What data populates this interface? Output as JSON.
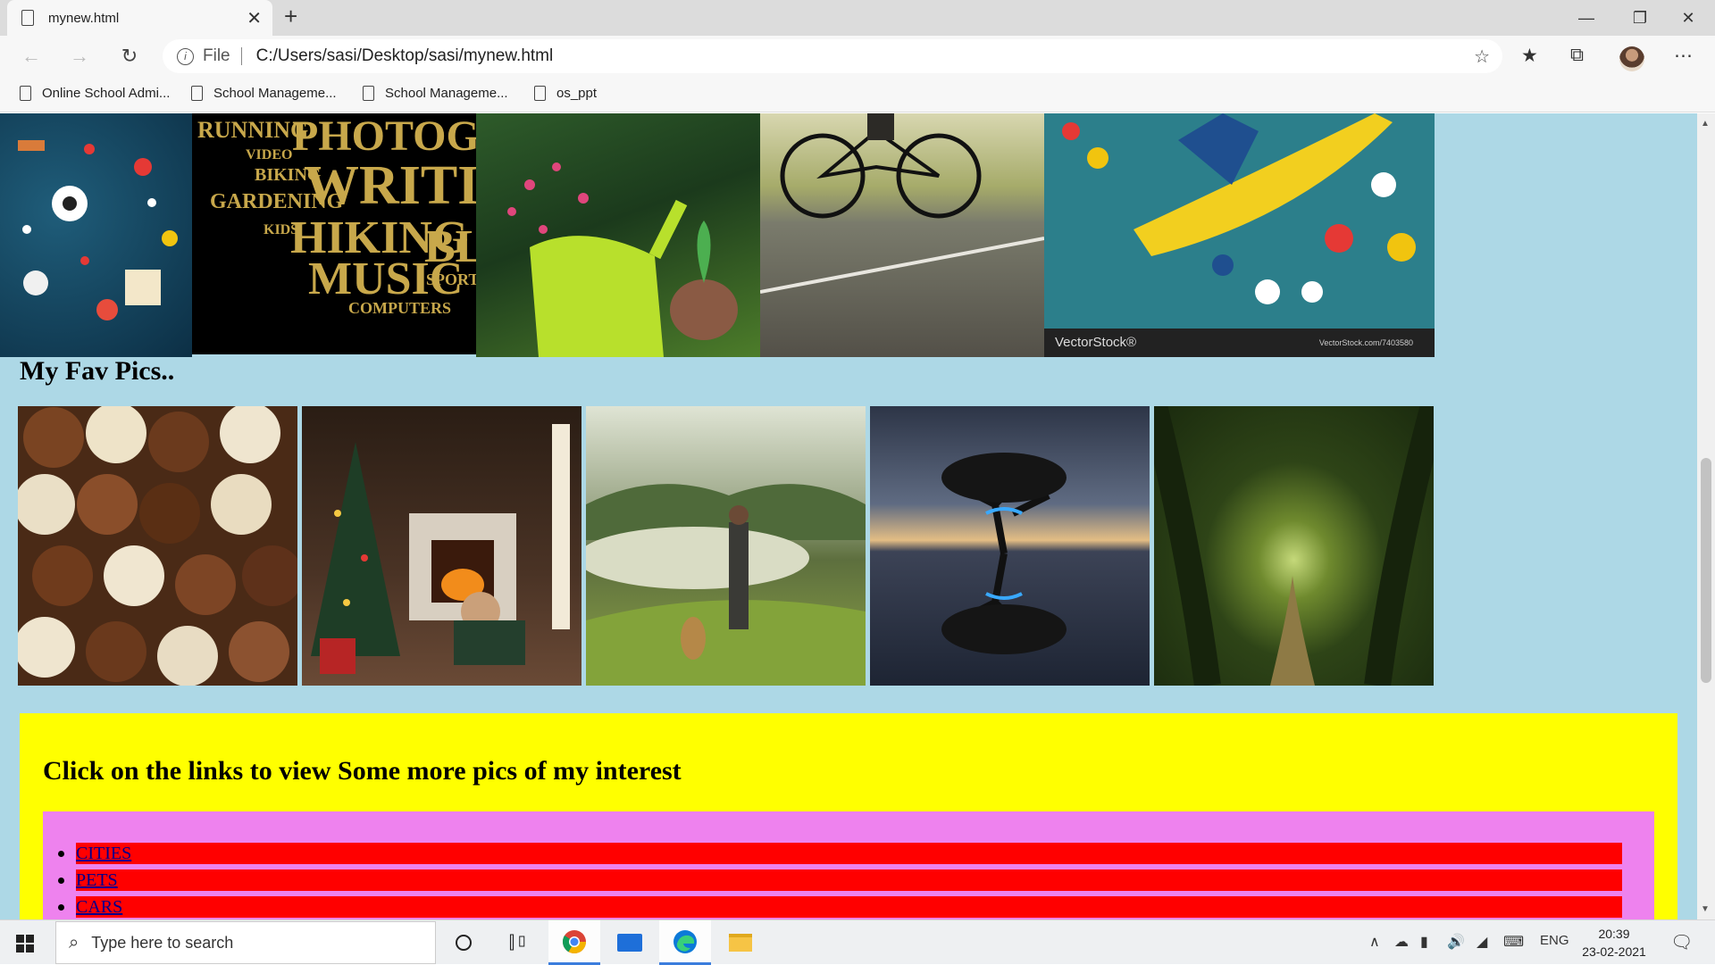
{
  "browser": {
    "tab_title": "mynew.html",
    "tab_close": "✕",
    "new_tab": "+",
    "address_scheme": "File",
    "address_path": "C:/Users/sasi/Desktop/sasi/mynew.html",
    "bookmarks": [
      "Online School Admi...",
      "School Manageme...",
      "School Manageme...",
      "os_ppt"
    ]
  },
  "top_tiles": {
    "vectorstock_brand": "VectorStock®",
    "vectorstock_id": "VectorStock.com/7403580",
    "wordcloud_words": [
      "RUNNING",
      "PHOTOGRAPHY",
      "WRITING",
      "GARDENING",
      "BIKING",
      "VIDEO",
      "HIKING",
      "MUSIC",
      "BLOG",
      "SPORTS",
      "COMPUTERS",
      "KIDS"
    ]
  },
  "page": {
    "fav_heading": "My Fav Pics..",
    "links_heading": "Click on the links to view Some more pics of my interest",
    "links": [
      "CITIES",
      "PETS",
      "CARS"
    ]
  },
  "taskbar": {
    "search_placeholder": "Type here to search",
    "lang": "ENG",
    "time": "20:39",
    "date": "23-02-2021"
  }
}
